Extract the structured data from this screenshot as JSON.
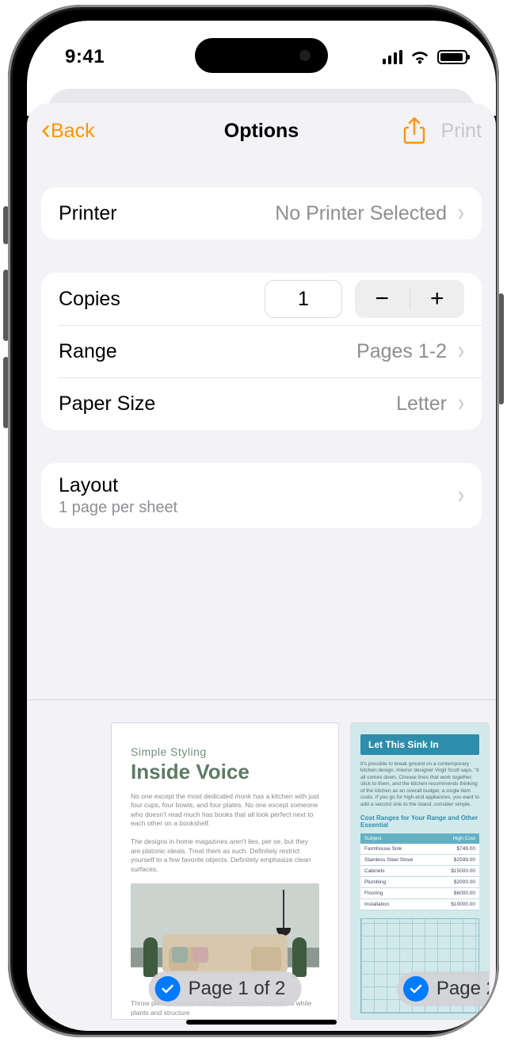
{
  "status": {
    "time": "9:41"
  },
  "nav": {
    "back": "Back",
    "title": "Options",
    "print": "Print"
  },
  "printer": {
    "label": "Printer",
    "value": "No Printer Selected"
  },
  "copies": {
    "label": "Copies",
    "value": "1"
  },
  "range": {
    "label": "Range",
    "value": "Pages 1-2"
  },
  "paper": {
    "label": "Paper Size",
    "value": "Letter"
  },
  "layout": {
    "label": "Layout",
    "sub": "1 page per sheet"
  },
  "preview": {
    "page1_label": "Page 1 of 2",
    "page2_label": "Page 2",
    "doc1": {
      "kicker": "Simple Styling",
      "headline": "Inside Voice"
    },
    "doc2": {
      "banner": "Let This Sink In",
      "subhead": "Cost Ranges for Your Range and Other Essential",
      "col1": "Subject",
      "col2": "High Cost",
      "rows": [
        {
          "name": "Farmhouse Sink",
          "cost": "$749.00"
        },
        {
          "name": "Stainless Steel Stove",
          "cost": "$2599.00"
        },
        {
          "name": "Cabinets",
          "cost": "$15000.00"
        },
        {
          "name": "Plumbing",
          "cost": "$2000.00"
        },
        {
          "name": "Flooring",
          "cost": "$6000.00"
        },
        {
          "name": "Installation",
          "cost": "$10000.00"
        }
      ]
    }
  }
}
